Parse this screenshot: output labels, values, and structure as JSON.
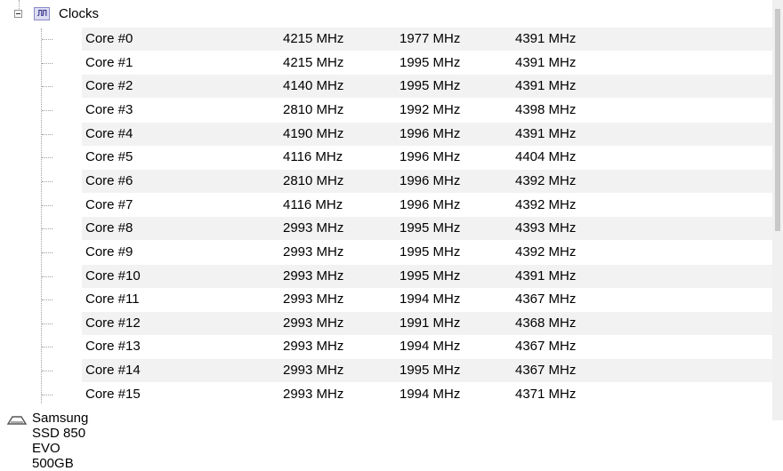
{
  "clocks": {
    "label": "Clocks",
    "icon": "clock-wave-icon",
    "icon_glyph": "ЛЛ",
    "rows": [
      {
        "name": "Core #0",
        "value": "4215 MHz",
        "min": "1977 MHz",
        "max": "4391 MHz"
      },
      {
        "name": "Core #1",
        "value": "4215 MHz",
        "min": "1995 MHz",
        "max": "4391 MHz"
      },
      {
        "name": "Core #2",
        "value": "4140 MHz",
        "min": "1995 MHz",
        "max": "4391 MHz"
      },
      {
        "name": "Core #3",
        "value": "2810 MHz",
        "min": "1992 MHz",
        "max": "4398 MHz"
      },
      {
        "name": "Core #4",
        "value": "4190 MHz",
        "min": "1996 MHz",
        "max": "4391 MHz"
      },
      {
        "name": "Core #5",
        "value": "4116 MHz",
        "min": "1996 MHz",
        "max": "4404 MHz"
      },
      {
        "name": "Core #6",
        "value": "2810 MHz",
        "min": "1996 MHz",
        "max": "4392 MHz"
      },
      {
        "name": "Core #7",
        "value": "4116 MHz",
        "min": "1996 MHz",
        "max": "4392 MHz"
      },
      {
        "name": "Core #8",
        "value": "2993 MHz",
        "min": "1995 MHz",
        "max": "4393 MHz"
      },
      {
        "name": "Core #9",
        "value": "2993 MHz",
        "min": "1995 MHz",
        "max": "4392 MHz"
      },
      {
        "name": "Core #10",
        "value": "2993 MHz",
        "min": "1995 MHz",
        "max": "4391 MHz"
      },
      {
        "name": "Core #11",
        "value": "2993 MHz",
        "min": "1994 MHz",
        "max": "4367 MHz"
      },
      {
        "name": "Core #12",
        "value": "2993 MHz",
        "min": "1991 MHz",
        "max": "4368 MHz"
      },
      {
        "name": "Core #13",
        "value": "2993 MHz",
        "min": "1994 MHz",
        "max": "4367 MHz"
      },
      {
        "name": "Core #14",
        "value": "2993 MHz",
        "min": "1995 MHz",
        "max": "4367 MHz"
      },
      {
        "name": "Core #15",
        "value": "2993 MHz",
        "min": "1994 MHz",
        "max": "4371 MHz"
      }
    ]
  },
  "next_node": {
    "label": "Samsung SSD 850 EVO 500GB",
    "icon": "disk-icon"
  }
}
